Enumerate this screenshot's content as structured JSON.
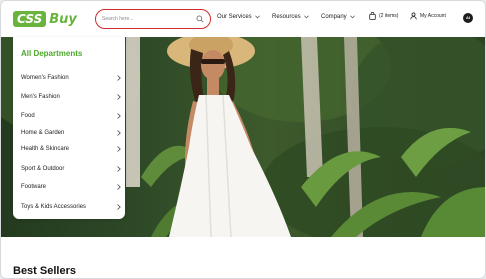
{
  "brand": {
    "badge": "CSS",
    "name": "Buy",
    "color": "#6ab33d"
  },
  "search": {
    "placeholder": "Search here..."
  },
  "nav": {
    "items": [
      {
        "label": "Our Services"
      },
      {
        "label": "Resources"
      },
      {
        "label": "Company"
      }
    ],
    "cart_label": "(2 items)",
    "account_label": "My Account",
    "avatar_initials": "AI"
  },
  "departments": {
    "title": "All Departments",
    "items": [
      {
        "label": "Women's Fashion"
      },
      {
        "label": "Men's Fashion"
      },
      {
        "label": "Food"
      },
      {
        "label": "Home & Garden"
      },
      {
        "label": "Health & Skincare"
      },
      {
        "label": "Sport & Outdoor"
      },
      {
        "label": "Footware"
      },
      {
        "label": "Toys & Kids Accessories"
      }
    ]
  },
  "sections": {
    "best_sellers": "Best Sellers"
  },
  "colors": {
    "accent": "#4ea82e",
    "search_border": "#d42a2a"
  }
}
